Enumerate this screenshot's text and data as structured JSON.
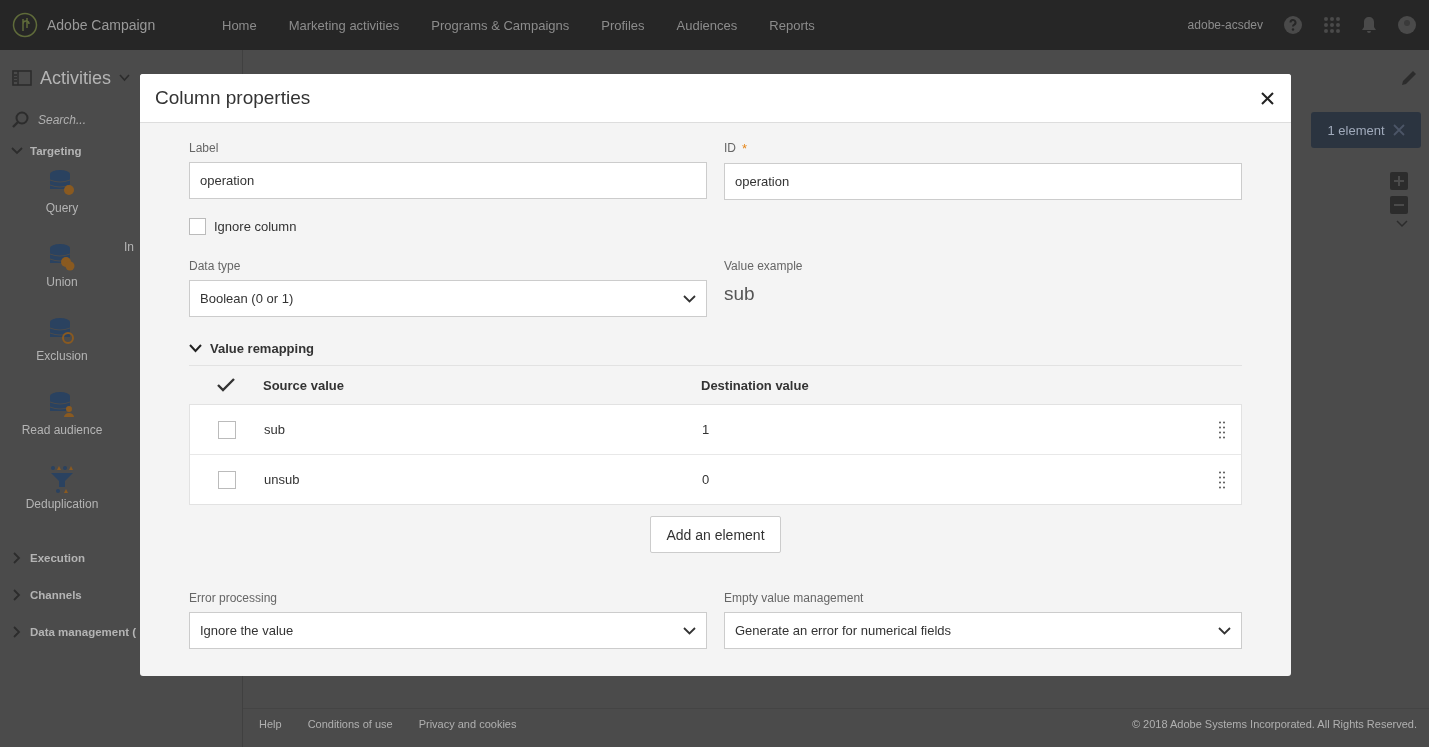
{
  "topbar": {
    "brand": "Adobe Campaign",
    "nav": [
      {
        "label": "Home"
      },
      {
        "label": "Marketing activities"
      },
      {
        "label": "Programs & Campaigns"
      },
      {
        "label": "Profiles"
      },
      {
        "label": "Audiences"
      },
      {
        "label": "Reports"
      }
    ],
    "user": "adobe-acsdev"
  },
  "sidebar": {
    "title": "Activities",
    "search_placeholder": "Search...",
    "groups": [
      {
        "label": "Targeting",
        "expanded": true,
        "items": [
          {
            "label": "Query",
            "kind": "query"
          },
          {
            "label": "Union",
            "kind": "union"
          },
          {
            "label": "Exclusion",
            "kind": "exclusion"
          },
          {
            "label": "Read audience",
            "kind": "audience"
          },
          {
            "label": "Deduplication",
            "kind": "dedup"
          }
        ],
        "column_2": [
          "In"
        ]
      },
      {
        "label": "Execution",
        "expanded": false
      },
      {
        "label": "Channels",
        "expanded": false
      },
      {
        "label": "Data management (",
        "expanded": false
      }
    ]
  },
  "canvas": {
    "selection_badge": "1 element"
  },
  "footer": {
    "links": [
      "Help",
      "Conditions of use",
      "Privacy and cookies"
    ],
    "copyright": "© 2018 Adobe Systems Incorporated. All Rights Reserved."
  },
  "dialog": {
    "title": "Column properties",
    "label_field": {
      "label": "Label",
      "value": "operation"
    },
    "id_field": {
      "label": "ID",
      "required_mark": "*",
      "value": "operation"
    },
    "ignore_column": {
      "label": "Ignore column",
      "checked": false
    },
    "data_type": {
      "label": "Data type",
      "value": "Boolean (0 or 1)"
    },
    "value_example": {
      "label": "Value example",
      "value": "sub"
    },
    "value_remapping": {
      "label": "Value remapping",
      "expanded": true,
      "columns": [
        "Source value",
        "Destination value"
      ],
      "rows": [
        {
          "source": "sub",
          "destination": "1",
          "checked": false
        },
        {
          "source": "unsub",
          "destination": "0",
          "checked": false
        }
      ],
      "add_button": "Add an element"
    },
    "error_processing": {
      "label": "Error processing",
      "value": "Ignore the value"
    },
    "empty_value": {
      "label": "Empty value management",
      "value": "Generate an error for numerical fields"
    }
  }
}
